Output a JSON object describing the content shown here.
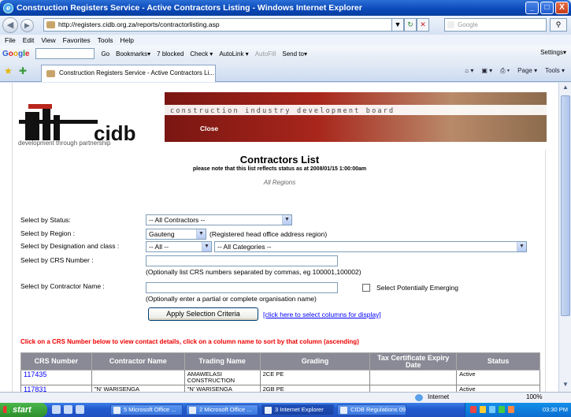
{
  "window": {
    "title": "Construction Registers Service - Active Contractors Listing - Windows Internet Explorer",
    "buttons": {
      "minimize": "_",
      "maximize": "□",
      "close": "X"
    }
  },
  "address_bar": {
    "url": "http://registers.cidb.org.za/reports/contractorlisting.asp",
    "search_placeholder": "Google",
    "back": "◀",
    "forward": "▶",
    "dropdown": "▼",
    "refresh": "↻",
    "stop": "✕",
    "search_go": "⚲"
  },
  "menu": [
    "File",
    "Edit",
    "View",
    "Favorites",
    "Tools",
    "Help"
  ],
  "google_toolbar": {
    "logo_letters": [
      "G",
      "o",
      "o",
      "g",
      "l",
      "e"
    ],
    "go": "Go",
    "items": [
      "Bookmarks▾",
      "7 blocked",
      "Check ▾",
      "AutoLink ▾",
      "AutoFill",
      "Send to▾"
    ],
    "settings": "Settings▾"
  },
  "tab": {
    "label": "Construction Registers Service - Active Contractors Li...",
    "tools": [
      "⌂ ▾",
      "▣ ▾",
      "⎙ ▾",
      "Page ▾",
      "Tools ▾"
    ]
  },
  "banner": {
    "board_name": "construction industry development board",
    "close": "Close",
    "logo_text": "cidb",
    "tagline": "development through partnership"
  },
  "heading": {
    "title": "Contractors List",
    "subtitle": "please note that this list reflects status as at 2008/01/15 1:00:00am",
    "region": "All Regions"
  },
  "form": {
    "status_label": "Select by Status:",
    "status_value": "-- All Contractors --",
    "region_label": "Select by Region :",
    "region_value": "Gauteng",
    "region_note": "(Registered head office address region)",
    "designation_label": "Select by Designation and class :",
    "designation_value": "-- All --",
    "category_value": "-- All Categories --",
    "crs_label": "Select by CRS Number :",
    "crs_note": "(Optionally list CRS numbers separated by commas, eg 100001,100002)",
    "name_label": "Select by Contractor Name :",
    "name_note": "(Optionally enter a partial or complete organisation name)",
    "emerging_label": "Select Potentially Emerging",
    "apply_button": "Apply Selection Criteria",
    "columns_link": "[click here to select columns for display]"
  },
  "instruction": "Click on a CRS Number below to view contact details, click on a column name to sort by that column (ascending)",
  "table": {
    "headers": [
      "CRS Number",
      "Contractor Name",
      "Trading Name",
      "Grading",
      "Tax Certificate Expiry Date",
      "Status"
    ],
    "rows": [
      [
        "117435",
        "",
        "AMAWELASI CONSTRUCTION",
        "2CE PE",
        "",
        "Active"
      ],
      [
        "117831",
        "\"N' WARISENGA",
        "\"N' WARISENGA",
        "2GB PE",
        "",
        "Active"
      ]
    ]
  },
  "statusbar": {
    "zone": "Internet",
    "zoom": "100%"
  },
  "taskbar": {
    "start": "start",
    "tasks": [
      "5 Microsoft Office ...",
      "2 Microsoft Office ...",
      "3 Internet Explorer",
      "CIDB Regulations 09..."
    ],
    "clock": "03:30 PM"
  }
}
